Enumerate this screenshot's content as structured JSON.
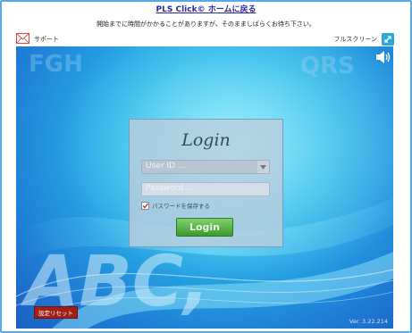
{
  "header": {
    "top_link": "PLS Click© ホームに戻る",
    "notice": "開始までに時間がかかることがありますが、そのまましばらくお待ち下さい。"
  },
  "toolbar": {
    "support_label": "サポート",
    "fullscreen_label": "フルスクリーン"
  },
  "login": {
    "title": "Login",
    "user_placeholder": "User ID ...",
    "password_placeholder": "Password ...",
    "save_password_label": "パスワードを保存する",
    "save_password_checked": true,
    "button_label": "Login"
  },
  "footer": {
    "reset_label": "設定リセット",
    "version": "Ver. 3.22.214"
  },
  "background": {
    "letters_left": "ABC,",
    "letters_top_left": "FGH",
    "letters_top_right": "QRS"
  },
  "colors": {
    "frame_border": "#5aa9e6",
    "link": "#2a2aa8",
    "login_button": "#3c9a2c",
    "reset_button": "#a21f18",
    "fullscreen_button": "#29a9d6"
  },
  "icons": {
    "support": "mail-icon",
    "fullscreen": "expand-icon",
    "sound": "speaker-icon"
  }
}
